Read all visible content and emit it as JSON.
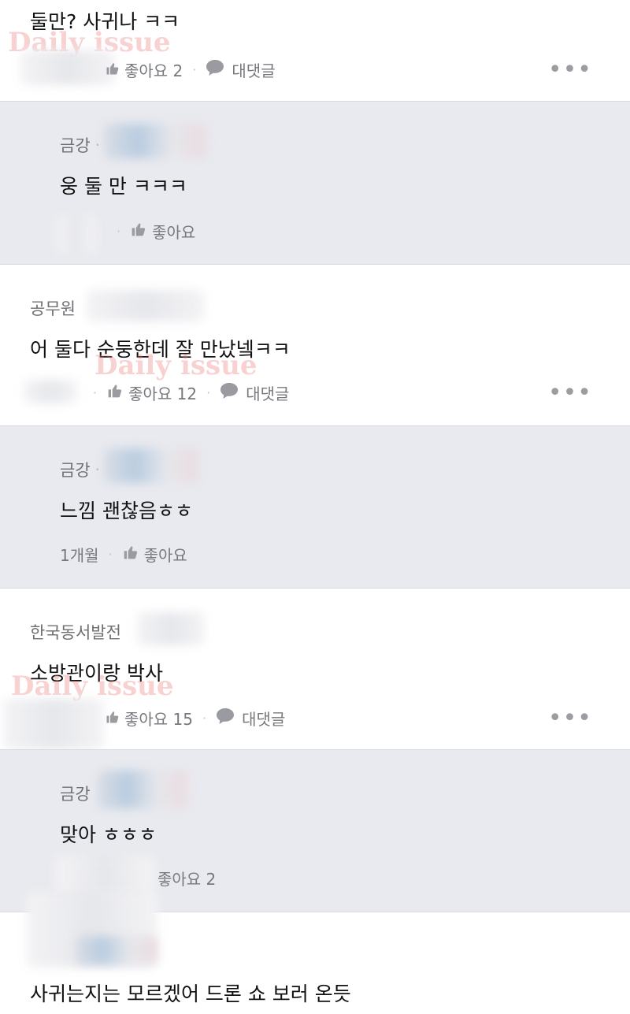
{
  "watermark": "Daily issue",
  "comments": [
    {
      "text": "둘만? 사귀나 ㅋㅋ",
      "likes_label": "좋아요 2",
      "reply_label": "대댓글"
    },
    {
      "author": "금강",
      "text": "웅 둘 만 ㅋㅋㅋ",
      "likes_label": "좋아요"
    },
    {
      "author": "공무원",
      "text": "어 둘다 순둥한데 잘 만났넼ㅋㅋ",
      "likes_label": "좋아요 12",
      "reply_label": "대댓글"
    },
    {
      "author": "금강",
      "text": "느낌 괜찮음ㅎㅎ",
      "time": "1개월",
      "likes_label": "좋아요"
    },
    {
      "author": "한국동서발전",
      "text": "소방관이랑 박사",
      "likes_label": "좋아요 15",
      "reply_label": "대댓글"
    },
    {
      "author": "금강",
      "text": "맞아 ㅎㅎㅎ",
      "likes_label": "좋아요 2"
    },
    {
      "text": "사귀는지는 모르겠어 드론 쇼 보러 온듯"
    }
  ],
  "more_label": "•••"
}
